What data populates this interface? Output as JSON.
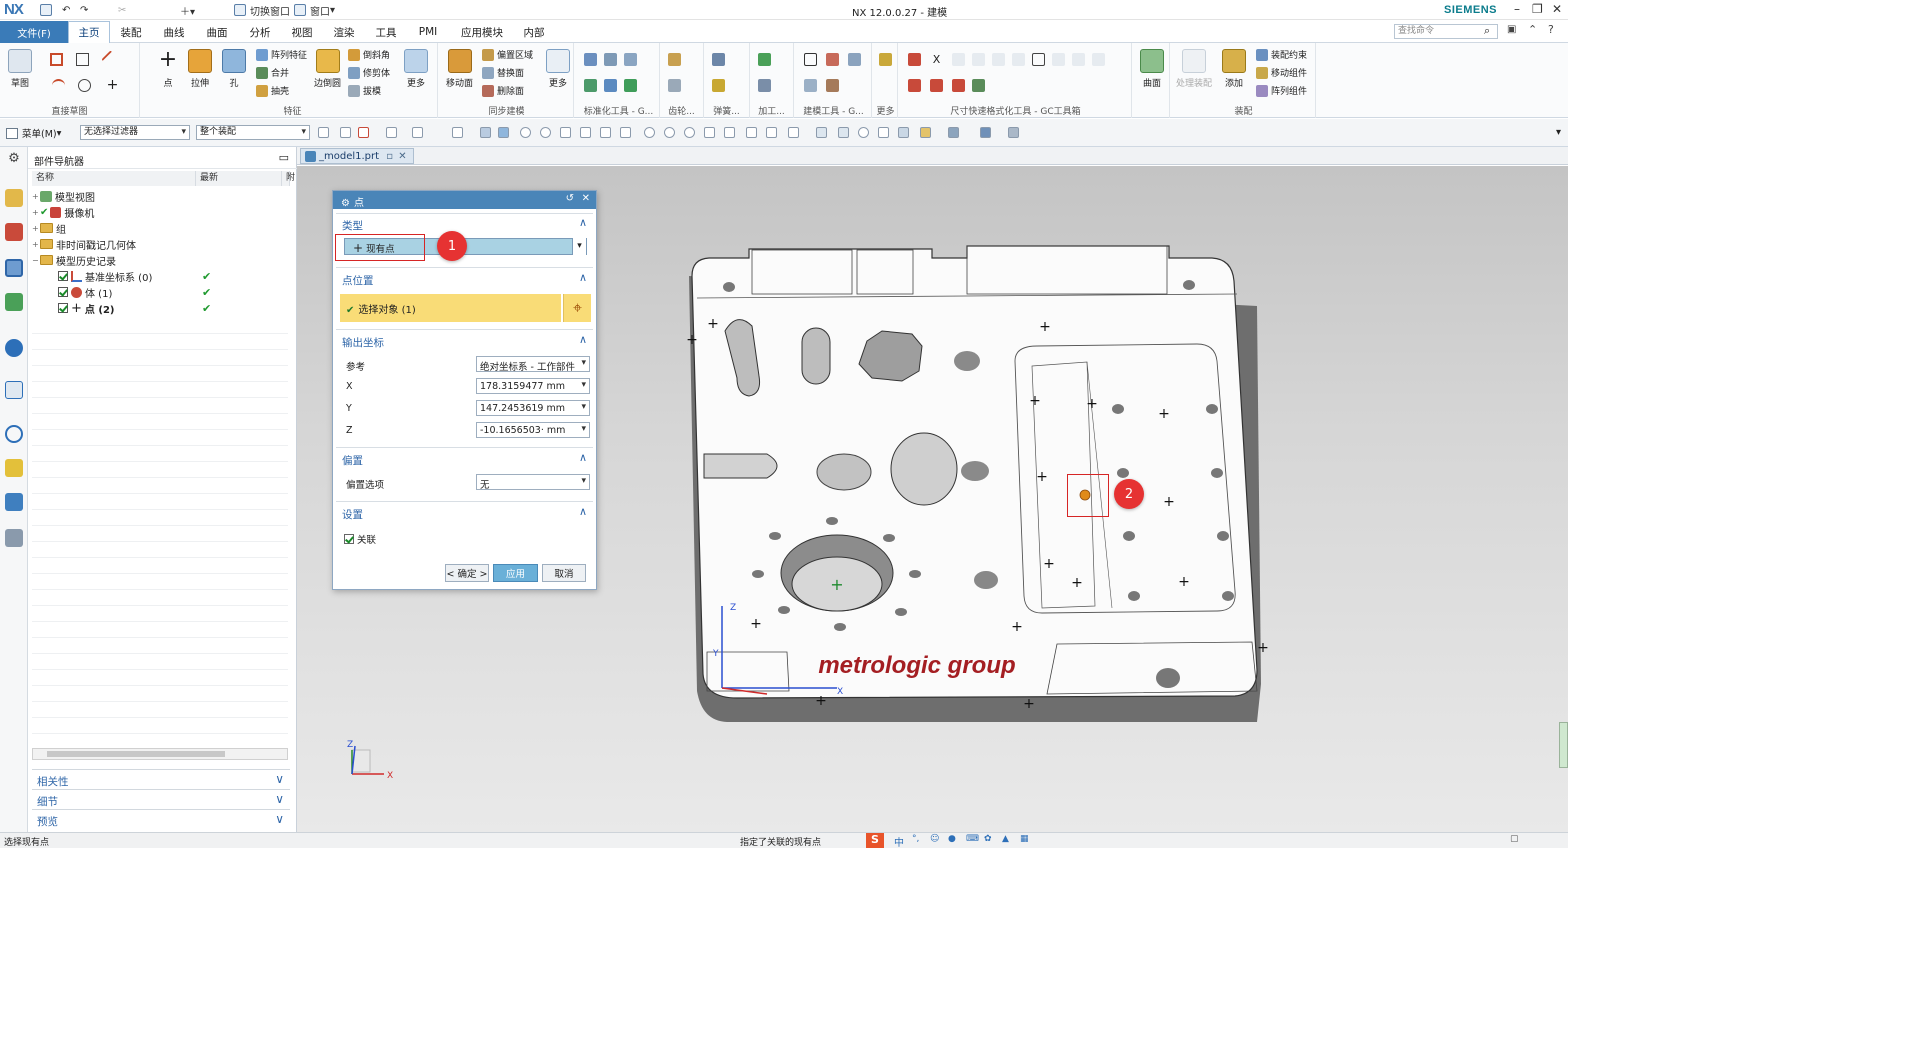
{
  "app": {
    "logo": "NX",
    "window_title": "NX 12.0.0.27 - 建模",
    "brand": "SIEMENS",
    "quick_access": {
      "switch_window": "切换窗口",
      "window": "窗口"
    }
  },
  "menubar": {
    "file": "文件(F)",
    "tabs": [
      "主页",
      "装配",
      "曲线",
      "曲面",
      "分析",
      "视图",
      "渲染",
      "工具",
      "PMI",
      "应用模块",
      "内部"
    ],
    "search_placeholder": "查找命令"
  },
  "ribbon": {
    "groups": {
      "direct_sketch": "直接草图",
      "feature": "特征",
      "sync_modeling": "同步建模",
      "std_tools": "标准化工具 - G...",
      "gear": "齿轮...",
      "spring": "弹簧...",
      "machining": "加工...",
      "modeling_tools": "建模工具 - G...",
      "more": "更多",
      "dimension_tools": "尺寸快速格式化工具 - GC工具箱",
      "assembly": "装配"
    },
    "buttons": {
      "sketch": "草图",
      "point": "点",
      "extrude": "拉伸",
      "hole": "孔",
      "pattern_feature": "阵列特征",
      "unite": "合并",
      "shell": "抽壳",
      "edge_blend": "边倒圆",
      "chamfer": "倒斜角",
      "trim_body": "修剪体",
      "draft": "拔模",
      "more": "更多",
      "move_face": "移动面",
      "offset_region": "偏置区域",
      "replace_face": "替换面",
      "delete_face": "删除面",
      "more2": "更多",
      "surface": "曲面",
      "process_assembly": "处理装配",
      "add": "添加",
      "assembly_constraint": "装配约束",
      "move_component": "移动组件",
      "pattern_component": "阵列组件"
    }
  },
  "filterbar": {
    "menu": "菜单(M)",
    "filter": "无选择过滤器",
    "scope": "整个装配"
  },
  "navigator": {
    "title": "部件导航器",
    "col_name": "名称",
    "col_latest": "最新",
    "col_other": "附",
    "tree": [
      {
        "label": "模型视图",
        "indent": 0
      },
      {
        "label": "摄像机",
        "indent": 0
      },
      {
        "label": "组",
        "indent": 0
      },
      {
        "label": "非时间戳记几何体",
        "indent": 0
      },
      {
        "label": "模型历史记录",
        "indent": 0
      },
      {
        "label": "基准坐标系 (0)",
        "indent": 1
      },
      {
        "label": "体 (1)",
        "indent": 1
      },
      {
        "label": "点 (2)",
        "indent": 1
      }
    ],
    "panels": [
      "相关性",
      "细节",
      "预览"
    ]
  },
  "document_tab": "_model1.prt",
  "dialog": {
    "title": "点",
    "type_header": "类型",
    "type_value": "现有点",
    "location_header": "点位置",
    "select_object": "选择对象 (1)",
    "output_header": "输出坐标",
    "ref_label": "参考",
    "ref_value": "绝对坐标系 - 工作部件",
    "x_label": "X",
    "x_value": "178.3159477",
    "y_label": "Y",
    "y_value": "147.2453619",
    "z_label": "Z",
    "z_value": "-10.1656503·",
    "unit": "mm",
    "offset_header": "偏置",
    "offset_label": "偏置选项",
    "offset_value": "无",
    "settings_header": "设置",
    "associative": "关联",
    "ok": "< 确定 >",
    "apply": "应用",
    "cancel": "取消"
  },
  "annotations": {
    "badge1": "1",
    "badge2": "2"
  },
  "model": {
    "logo_text": "metrologic group",
    "axis_x": "X",
    "axis_y": "Y",
    "axis_z": "Z"
  },
  "status": {
    "left": "选择现有点",
    "center": "指定了关联的现有点",
    "ime": "中"
  },
  "colors": {
    "accent": "#3a7bb8",
    "dialog_title": "#4a85b8",
    "highlight_yellow": "#f9dc77",
    "type_field": "#a9d2e3",
    "badge_red": "#e63232",
    "logo_red": "#a41e22",
    "selected_point": "#e08a1a"
  }
}
